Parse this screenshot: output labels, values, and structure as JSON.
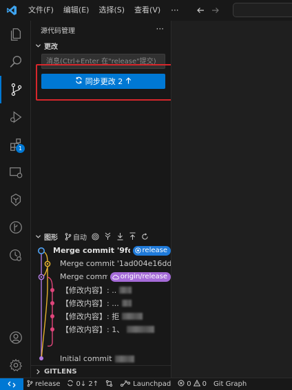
{
  "titlebar": {
    "menus": [
      "文件(F)",
      "编辑(E)",
      "选择(S)",
      "查看(V)"
    ],
    "more": "···"
  },
  "activity_bar": {
    "items": [
      "explorer",
      "search",
      "source-control",
      "run-debug",
      "extensions",
      "remote-explorer",
      "gitlens",
      "git-graph",
      "timeline"
    ],
    "extensions_badge": "1",
    "active": "source-control"
  },
  "sidebar": {
    "title": "源代码管理",
    "more": "···",
    "changes_header": "更改",
    "commit_input_placeholder": "消息(Ctrl+Enter 在\"release\"提交)",
    "sync_button_label": "同步更改 2",
    "graph": {
      "title": "图形",
      "auto_label": "自动",
      "commits": [
        {
          "message": "Merge commit '9fd1a...",
          "tag": "release",
          "bold": true
        },
        {
          "message": "Merge commit '1ad004e16dd...",
          "tag": ""
        },
        {
          "message": "Merge comm...",
          "tag": "origin/release"
        },
        {
          "message": "【修改内容】: ..",
          "tag": ""
        },
        {
          "message": "【修改内容】: ...",
          "tag": ""
        },
        {
          "message": "【修改内容】: 拒",
          "tag": ""
        },
        {
          "message": "【修改内容】: 1、",
          "tag": ""
        },
        {
          "message": "Initial commit",
          "tag": ""
        }
      ]
    },
    "gitlens_header": "GITLENS"
  },
  "status_bar": {
    "branch": "release",
    "sync": "0↓ 2↑",
    "launchpad": "Launchpad",
    "errors": "0",
    "warnings": "0",
    "git_graph": "Git Graph"
  },
  "colors": {
    "accent": "#0078d4",
    "highlight": "#d7262b",
    "graph_blue": "#4fa3f7",
    "graph_yellow": "#e5b12e",
    "graph_purple": "#b07ae0",
    "graph_pink": "#e0457b"
  }
}
